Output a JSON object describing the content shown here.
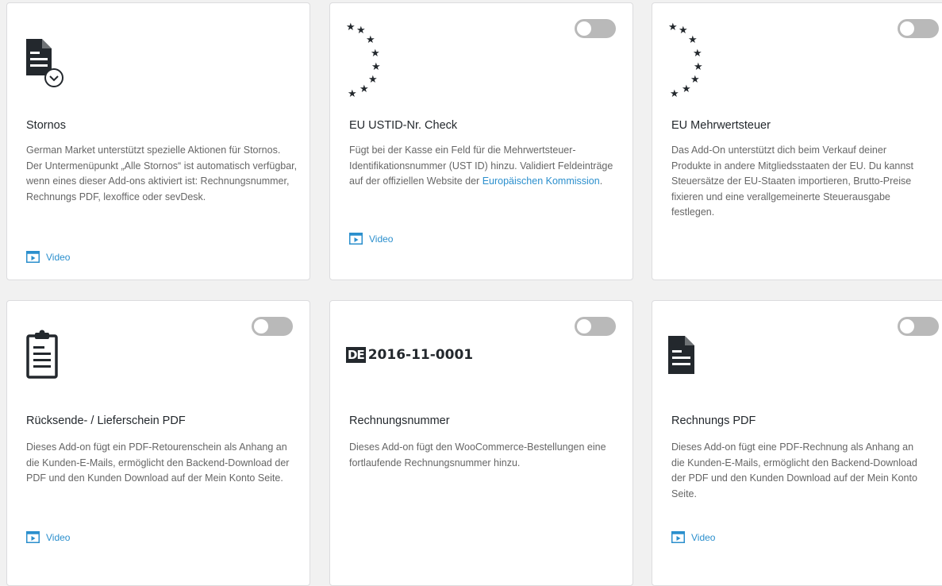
{
  "colors": {
    "link": "#2b8fcd",
    "icon": "#23282d",
    "toggle_off": "#b9b9b9"
  },
  "cards": [
    {
      "title": "Stornos",
      "icon": "document-check-icon",
      "toggle": null,
      "desc": "German Market unterstützt spezielle Aktionen für Stornos. Der Untermenüpunkt „Alle Stornos“ ist automatisch verfügbar, wenn eines dieser Add-ons aktiviert ist: Rechnungsnummer, Rechnungs PDF, lexoffice oder sevDesk.",
      "video": "Video"
    },
    {
      "title": "EU USTID-Nr. Check",
      "icon": "eu-stars-icon",
      "toggle": "off",
      "desc": "Fügt bei der Kasse ein Feld für die Mehrwertsteuer-Identifikationsnummer (UST ID) hinzu. Validiert Feldeinträge auf der offiziellen Website der",
      "desc_link": "Europäischen Kommission",
      "desc_end": ".",
      "video": "Video"
    },
    {
      "title": "EU Mehrwertsteuer",
      "icon": "eu-stars-icon",
      "toggle": "off",
      "desc": "Das Add-On unterstützt dich beim Verkauf deiner Produkte in andere Mitgliedsstaaten der EU. Du kannst Steuersätze der EU-Staaten importieren, Brutto-Preise fixieren und eine verallgemeinerte Steuerausgabe festlegen."
    },
    {
      "title": "Rücksende- / Lieferschein PDF",
      "icon": "clipboard-icon",
      "toggle": "off",
      "desc": "Dieses Add-on fügt ein PDF-Retourenschein als Anhang an die Kunden-E-Mails, ermöglicht den Backend-Download der PDF und den Kunden Download auf der Mein Konto Seite.",
      "video": "Video"
    },
    {
      "title": "Rechnungsnummer",
      "icon": "invoice-number-icon",
      "badge": "DE",
      "number": "2016-11-0001",
      "toggle": "off",
      "desc": "Dieses Add-on fügt den WooCommerce-Bestellungen eine fortlaufende Rechnungsnummer hinzu."
    },
    {
      "title": "Rechnungs PDF",
      "icon": "document-icon",
      "toggle": "off",
      "desc": "Dieses Add-on fügt eine PDF-Rechnung als Anhang an die Kunden-E-Mails, ermöglicht den Backend-Download der PDF und den Kunden Download auf der Mein Konto Seite.",
      "video": "Video"
    }
  ]
}
